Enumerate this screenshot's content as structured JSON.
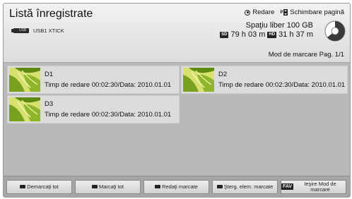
{
  "header": {
    "title": "Listă înregistrate",
    "device": "USB1 XTICK",
    "legend": {
      "play": "Redare",
      "page_change": "Schimbare pagină"
    },
    "free_space": "Spaţiu liber 100 GB",
    "sd_badge": "SD",
    "sd_time": "79 h 03 m",
    "hd_badge": "HD",
    "hd_time": "31 h 37 m",
    "mark_mode": "Mod de marcare Pag. 1/1"
  },
  "recordings": [
    {
      "name": "D1",
      "info": "Timp de redare 00:02:30/Data: 2010.01.01"
    },
    {
      "name": "D2",
      "info": "Timp de redare 00:02:30/Data: 2010.01.01"
    },
    {
      "name": "D3",
      "info": "Timp de redare 00:02:30/Data: 2010.01.01"
    }
  ],
  "footer": {
    "buttons": [
      {
        "label": "Demarcaţi tot",
        "key_color": "#222222"
      },
      {
        "label": "Marcaţi tot",
        "key_color": "#222222"
      },
      {
        "label": "Redaţi marcate",
        "key_color": "#222222"
      },
      {
        "label": "Şterg. elem. marcate",
        "key_color": "#222222"
      },
      {
        "label": "Ieşire Mod de marcare",
        "key": "FAV"
      }
    ]
  },
  "colors": {
    "list_background": "#b9b9b9",
    "card_background": "#dcdcdc",
    "thumbnail_green": "#7aa01f"
  }
}
